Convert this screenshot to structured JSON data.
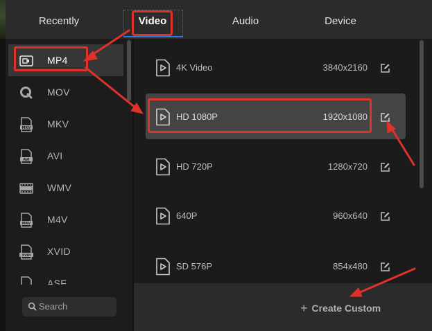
{
  "tabs": [
    {
      "label": "Recently"
    },
    {
      "label": "Video"
    },
    {
      "label": "Audio"
    },
    {
      "label": "Device"
    }
  ],
  "sidebar": {
    "items": [
      {
        "label": "MP4",
        "icon": "mp4-file-icon"
      },
      {
        "label": "MOV",
        "icon": "mov-quicktime-icon"
      },
      {
        "label": "MKV",
        "icon": "mkv-file-icon"
      },
      {
        "label": "AVI",
        "icon": "avi-file-icon"
      },
      {
        "label": "WMV",
        "icon": "wmv-file-icon"
      },
      {
        "label": "M4V",
        "icon": "m4v-file-icon"
      },
      {
        "label": "XVID",
        "icon": "xvid-file-icon"
      },
      {
        "label": "ASF",
        "icon": "asf-file-icon"
      }
    ],
    "search_placeholder": "Search"
  },
  "presets": [
    {
      "name": "4K Video",
      "resolution": "3840x2160"
    },
    {
      "name": "HD 1080P",
      "resolution": "1920x1080"
    },
    {
      "name": "HD 720P",
      "resolution": "1280x720"
    },
    {
      "name": "640P",
      "resolution": "960x640"
    },
    {
      "name": "SD 576P",
      "resolution": "854x480"
    }
  ],
  "create_custom_label": "Create Custom",
  "colors": {
    "annotation": "#e0322a",
    "tab_underline": "#2d7be0",
    "panel_bg": "#1b1b1b",
    "bar_bg": "#2b2b2b"
  }
}
